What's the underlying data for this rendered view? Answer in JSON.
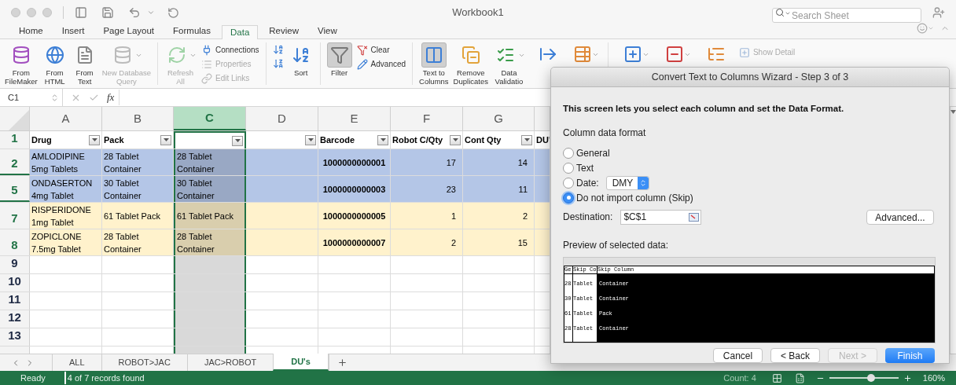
{
  "window": {
    "title": "Workbook1",
    "search": {
      "placeholder": "Search Sheet"
    }
  },
  "menu_tabs": [
    {
      "label": "Home",
      "selected": false
    },
    {
      "label": "Insert",
      "selected": false
    },
    {
      "label": "Page Layout",
      "selected": false
    },
    {
      "label": "Formulas",
      "selected": false
    },
    {
      "label": "Data",
      "selected": true
    },
    {
      "label": "Review",
      "selected": false
    },
    {
      "label": "View",
      "selected": false
    }
  ],
  "ribbon": {
    "groups": [
      {
        "items": [
          {
            "kind": "large",
            "label": "From\nFileMaker",
            "disabled": false,
            "pressed": false,
            "dropdown": false
          },
          {
            "kind": "large",
            "label": "From\nHTML",
            "disabled": false,
            "pressed": false,
            "dropdown": false
          },
          {
            "kind": "large",
            "label": "From\nText",
            "disabled": false,
            "pressed": false,
            "dropdown": false
          },
          {
            "kind": "large",
            "label": "New Database\nQuery",
            "disabled": true,
            "pressed": false,
            "dropdown": true
          }
        ]
      },
      {
        "items": [
          {
            "kind": "large",
            "label": "Refresh\nAll",
            "disabled": true,
            "pressed": false,
            "dropdown": true
          },
          {
            "kind": "stack",
            "items": [
              {
                "kind": "label",
                "label": "Connections",
                "disabled": false
              },
              {
                "kind": "label",
                "label": "Properties",
                "disabled": true
              },
              {
                "kind": "label",
                "label": "Edit Links",
                "disabled": true
              }
            ]
          }
        ]
      },
      {
        "items": [
          {
            "kind": "stack",
            "items": [
              {
                "kind": "icon"
              },
              {
                "kind": "icon"
              }
            ]
          },
          {
            "kind": "large",
            "label": "Sort",
            "disabled": false,
            "pressed": false,
            "dropdown": false
          }
        ]
      },
      {
        "items": [
          {
            "kind": "large",
            "label": "Filter",
            "disabled": false,
            "pressed": true,
            "dropdown": false
          },
          {
            "kind": "stack",
            "items": [
              {
                "kind": "label",
                "label": "Clear",
                "disabled": false
              },
              {
                "kind": "label",
                "label": "Advanced",
                "disabled": false
              }
            ]
          }
        ]
      },
      {
        "items": [
          {
            "kind": "large",
            "label": "Text to\nColumns",
            "disabled": false,
            "pressed": true,
            "dropdown": false
          },
          {
            "kind": "large",
            "label": "Remove\nDuplicates",
            "disabled": false,
            "pressed": false,
            "dropdown": false
          },
          {
            "kind": "large",
            "label": "Data\nValidatio",
            "disabled": false,
            "pressed": false,
            "dropdown": true
          },
          {
            "kind": "icon",
            "dropdown": false
          },
          {
            "kind": "icon",
            "dropdown": true
          }
        ]
      },
      {
        "items": [
          {
            "kind": "icon",
            "dropdown": true
          },
          {
            "kind": "icon",
            "dropdown": true
          },
          {
            "kind": "icon",
            "dropdown": false
          },
          {
            "kind": "small",
            "label": "Show Detail",
            "disabled": true
          }
        ]
      }
    ]
  },
  "formula_bar": {
    "name_box": "C1",
    "function_label": "fx"
  },
  "sheet": {
    "columns": [
      {
        "letter": "A",
        "selected": false
      },
      {
        "letter": "B",
        "selected": false
      },
      {
        "letter": "C",
        "selected": true
      },
      {
        "letter": "D",
        "selected": false
      },
      {
        "letter": "E",
        "selected": false
      },
      {
        "letter": "F",
        "selected": false
      },
      {
        "letter": "G",
        "selected": false
      }
    ],
    "rows": [
      {
        "number": "1",
        "filtered": true,
        "kind": "header",
        "cells": [
          {
            "text": "Drug",
            "filter": true
          },
          {
            "text": "Pack",
            "filter": true
          },
          {
            "filter": true
          },
          {
            "filter": true
          },
          {
            "text": "Barcode",
            "filter": true
          },
          {
            "text": "Robot C/Qty",
            "filter": true
          },
          {
            "text": "Cont Qty",
            "filter": true
          },
          {
            "text": "DU'"
          }
        ]
      },
      {
        "number": "2",
        "filtered": true,
        "kind": "data",
        "rows_hidden_below": true,
        "color": "#b4c6e7",
        "cells": [
          "AMLODIPINE\n5mg Tablets",
          "28 Tablet\nContainer",
          "28 Tablet\nContainer",
          null,
          "1000000000001",
          "17",
          "14",
          null
        ]
      },
      {
        "number": "5",
        "filtered": true,
        "kind": "data",
        "rows_hidden_below": true,
        "color": "#b4c6e7",
        "cells": [
          "ONDASERTON\n4mg Tablet",
          "30 Tablet\nContainer",
          "30 Tablet\nContainer",
          null,
          "1000000000003",
          "23",
          "11",
          null
        ]
      },
      {
        "number": "7",
        "filtered": true,
        "kind": "data",
        "rows_hidden_below": false,
        "color": "#fff2cc",
        "cells": [
          "RISPERIDONE\n1mg Tablet",
          "61 Tablet Pack",
          "61 Tablet Pack",
          null,
          "1000000000005",
          "1",
          "2",
          null
        ]
      },
      {
        "number": "8",
        "filtered": true,
        "kind": "data",
        "rows_hidden_below": false,
        "color": "#fff2cc",
        "cells": [
          "ZOPICLONE\n7.5mg Tablet",
          "28 Tablet\nContainer",
          "28 Tablet\nContainer",
          null,
          "1000000000007",
          "2",
          "15",
          null
        ]
      },
      {
        "number": "9",
        "filtered": false,
        "kind": "empty"
      },
      {
        "number": "10",
        "filtered": false,
        "kind": "empty"
      },
      {
        "number": "11",
        "filtered": false,
        "kind": "empty"
      },
      {
        "number": "12",
        "filtered": false,
        "kind": "empty"
      },
      {
        "number": "13",
        "filtered": false,
        "kind": "empty"
      }
    ]
  },
  "sheet_tabs": [
    {
      "label": "ALL",
      "selected": false
    },
    {
      "label": "ROBOT>JAC",
      "selected": false
    },
    {
      "label": "JAC>ROBOT",
      "selected": false
    },
    {
      "label": "DU's",
      "selected": true
    }
  ],
  "status_bar": {
    "state": "Ready",
    "filter_info": "4 of 7 records found",
    "count": "Count: 4",
    "zoom": {
      "level": 0.6,
      "reading": "160%"
    }
  },
  "dialog": {
    "title": "Convert Text to Columns Wizard - Step 3 of 3",
    "intro": "This screen lets you select each column and set the Data Format.",
    "format_label": "Column data format",
    "formats": [
      {
        "kind": "plain",
        "label": "General",
        "selected": false
      },
      {
        "kind": "plain",
        "label": "Text",
        "selected": false
      },
      {
        "kind": "date",
        "label": "Date:",
        "value": "DMY",
        "selected": false
      },
      {
        "kind": "plain",
        "label": "Do not import column (Skip)",
        "selected": true
      }
    ],
    "destination": {
      "label": "Destination:",
      "value": "$C$1"
    },
    "advanced_button": "Advanced...",
    "preview": {
      "label": "Preview of selected data:",
      "columns": [
        {
          "header": "Ge",
          "selected": false
        },
        {
          "header": "Skip Co",
          "selected": false
        },
        {
          "header": "Skip Column",
          "selected": true
        }
      ],
      "rows": [
        [
          "28",
          "Tablet",
          "Container"
        ],
        [
          "30",
          "Tablet",
          "Container"
        ],
        [
          "61",
          "Tablet",
          "Pack"
        ],
        [
          "28",
          "Tablet",
          "Container"
        ]
      ]
    },
    "buttons": [
      {
        "label": "Cancel",
        "primary": false,
        "disabled": false
      },
      {
        "label": "< Back",
        "primary": false,
        "disabled": false
      },
      {
        "label": "Next >",
        "primary": false,
        "disabled": true
      },
      {
        "label": "Finish",
        "primary": true,
        "disabled": false
      }
    ]
  }
}
